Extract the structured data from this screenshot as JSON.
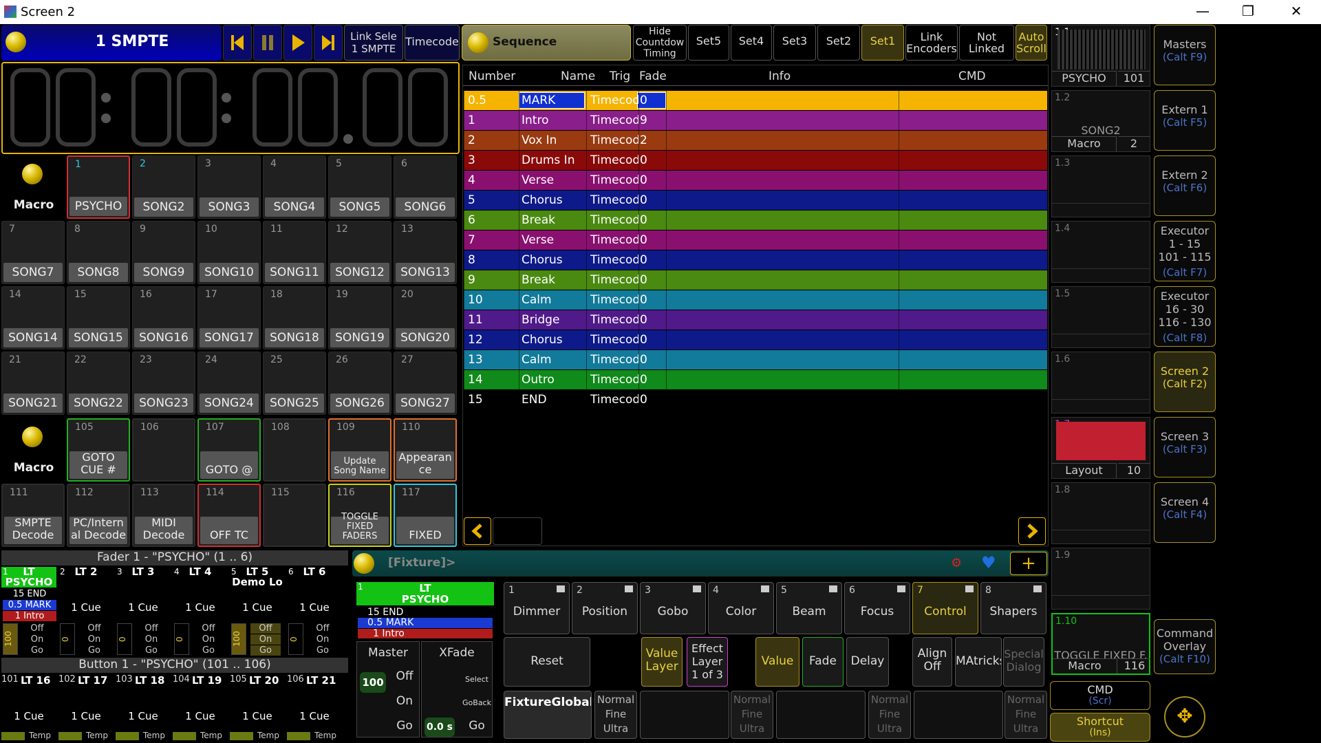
{
  "window": {
    "title": "Screen 2",
    "min": "—",
    "max": "❐",
    "close": "✕"
  },
  "timecode_bar": {
    "title": "1 SMPTE",
    "link_select": "Link Sele\n1 SMPTE",
    "timecode": "Timecode",
    "display": [
      "00",
      ":",
      "00",
      ":",
      "00",
      ".",
      "00"
    ]
  },
  "macro_label": "Macro",
  "song_grid": [
    {
      "n": "1",
      "name": "PSYCHO",
      "active": true
    },
    {
      "n": "2",
      "name": "SONG2"
    },
    {
      "n": "3",
      "name": "SONG3"
    },
    {
      "n": "4",
      "name": "SONG4"
    },
    {
      "n": "5",
      "name": "SONG5"
    },
    {
      "n": "6",
      "name": "SONG6"
    },
    {
      "n": "7",
      "name": "SONG7"
    },
    {
      "n": "8",
      "name": "SONG8"
    },
    {
      "n": "9",
      "name": "SONG9"
    },
    {
      "n": "10",
      "name": "SONG10"
    },
    {
      "n": "11",
      "name": "SONG11"
    },
    {
      "n": "12",
      "name": "SONG12"
    },
    {
      "n": "13",
      "name": "SONG13"
    },
    {
      "n": "14",
      "name": "SONG14"
    },
    {
      "n": "15",
      "name": "SONG15"
    },
    {
      "n": "16",
      "name": "SONG16"
    },
    {
      "n": "17",
      "name": "SONG17"
    },
    {
      "n": "18",
      "name": "SONG18"
    },
    {
      "n": "19",
      "name": "SONG19"
    },
    {
      "n": "20",
      "name": "SONG20"
    },
    {
      "n": "21",
      "name": "SONG21"
    },
    {
      "n": "22",
      "name": "SONG22"
    },
    {
      "n": "23",
      "name": "SONG23"
    },
    {
      "n": "24",
      "name": "SONG24"
    },
    {
      "n": "25",
      "name": "SONG25"
    },
    {
      "n": "26",
      "name": "SONG26"
    },
    {
      "n": "27",
      "name": "SONG27"
    }
  ],
  "macro_grid": [
    {
      "n": "105",
      "name": "GOTO\nCUE #",
      "border": "#23b023"
    },
    {
      "n": "106",
      "name": "",
      "border": "#2c2c2c"
    },
    {
      "n": "107",
      "name": "GOTO @",
      "border": "#23b023"
    },
    {
      "n": "108",
      "name": "",
      "border": "#2c2c2c"
    },
    {
      "n": "109",
      "name": "Update\nSong Name",
      "border": "#e07030",
      "small": true
    },
    {
      "n": "110",
      "name": "Appearan\nce",
      "border": "#e07030"
    },
    {
      "n": "111",
      "name": "SMPTE\nDecode",
      "border": "#2c2c2c"
    },
    {
      "n": "112",
      "name": "PC/Intern\nal Decode",
      "border": "#2c2c2c"
    },
    {
      "n": "113",
      "name": "MIDI\nDecode",
      "border": "#2c2c2c"
    },
    {
      "n": "114",
      "name": "OFF TC",
      "border": "#d23030"
    },
    {
      "n": "115",
      "name": "",
      "border": "#2c2c2c"
    },
    {
      "n": "116",
      "name": "TOGGLE\nFIXED\nFADERS",
      "border": "#c8d020",
      "small": true
    },
    {
      "n": "117",
      "name": "FIXED",
      "border": "#30c8e0"
    }
  ],
  "sequence": {
    "title": "Sequence",
    "buttons": [
      "Hide\nCountdow\nTiming",
      "Set5",
      "Set4",
      "Set3",
      "Set2",
      "Set1",
      "Link\nEncoders",
      "Not\nLinked",
      "Auto\nScroll"
    ],
    "headers": [
      "Number",
      "Name",
      "Trig",
      "Fade",
      "Info",
      "CMD"
    ],
    "rows": [
      {
        "num": "0.5",
        "name": "MARK",
        "trig": "Timecode",
        "fade": "0",
        "color": "#f5b400"
      },
      {
        "num": "1",
        "name": "Intro",
        "trig": "Timecode",
        "fade": "9",
        "color": "#8a1e8a"
      },
      {
        "num": "2",
        "name": "Vox In",
        "trig": "Timecode",
        "fade": "2",
        "color": "#9a3a10"
      },
      {
        "num": "3",
        "name": "Drums In",
        "trig": "Timecode",
        "fade": "0",
        "color": "#8a0a0a"
      },
      {
        "num": "4",
        "name": "Verse",
        "trig": "Timecode",
        "fade": "0",
        "color": "#8a1070"
      },
      {
        "num": "5",
        "name": "Chorus",
        "trig": "Timecode",
        "fade": "0",
        "color": "#0e1a8a"
      },
      {
        "num": "6",
        "name": "Break",
        "trig": "Timecode",
        "fade": "0",
        "color": "#4a8a10"
      },
      {
        "num": "7",
        "name": "Verse",
        "trig": "Timecode",
        "fade": "0",
        "color": "#8a1070"
      },
      {
        "num": "8",
        "name": "Chorus",
        "trig": "Timecode",
        "fade": "0",
        "color": "#0e1a8a"
      },
      {
        "num": "9",
        "name": "Break",
        "trig": "Timecode",
        "fade": "0",
        "color": "#4a8a10"
      },
      {
        "num": "10",
        "name": "Calm",
        "trig": "Timecode",
        "fade": "0",
        "color": "#127a9a"
      },
      {
        "num": "11",
        "name": "Bridge",
        "trig": "Timecode",
        "fade": "0",
        "color": "#501a8a"
      },
      {
        "num": "12",
        "name": "Chorus",
        "trig": "Timecode",
        "fade": "0",
        "color": "#0e1a8a"
      },
      {
        "num": "13",
        "name": "Calm",
        "trig": "Timecode",
        "fade": "0",
        "color": "#127a9a"
      },
      {
        "num": "14",
        "name": "Outro",
        "trig": "Timecode",
        "fade": "0",
        "color": "#108a1a"
      },
      {
        "num": "15",
        "name": "END",
        "trig": "Timecode",
        "fade": "0",
        "color": "#000000"
      }
    ]
  },
  "fader_section": {
    "title": "Fader  1  - \"PSYCHO\" (1 .. 6)",
    "button_title": "Button  1  - \"PSYCHO\" (101 .. 106)"
  },
  "faders": [
    {
      "n": "1",
      "name": "LT\nPSYCHO",
      "cues": [
        "15 END",
        "0.5 MARK",
        "1 Intro"
      ],
      "ctl": [
        "Off",
        "On",
        "Go"
      ],
      "val": "100",
      "active": true
    },
    {
      "n": "2",
      "name": "LT  2",
      "cue": "1 Cue",
      "ctl": [
        "Off",
        "On",
        "Go"
      ],
      "val": "0"
    },
    {
      "n": "3",
      "name": "LT  3",
      "cue": "1 Cue",
      "ctl": [
        "Off",
        "On",
        "Go"
      ],
      "val": "0"
    },
    {
      "n": "4",
      "name": "LT  4",
      "cue": "1 Cue",
      "ctl": [
        "Off",
        "On",
        "Go"
      ],
      "val": "0"
    },
    {
      "n": "5",
      "name": "LT  5\nDemo Lo",
      "cue": "1 Cue",
      "ctl": [
        "Off",
        "On",
        "Go"
      ],
      "val": "100"
    },
    {
      "n": "6",
      "name": "LT  6",
      "cue": "1 Cue",
      "ctl": [
        "Off",
        "On",
        "Go"
      ],
      "val": "0"
    }
  ],
  "buttons_row": [
    {
      "n": "101",
      "name": "LT 16",
      "cue": "1 Cue",
      "temp": "Temp"
    },
    {
      "n": "102",
      "name": "LT 17",
      "cue": "1 Cue",
      "temp": "Temp"
    },
    {
      "n": "103",
      "name": "LT 18",
      "cue": "1 Cue",
      "temp": "Temp"
    },
    {
      "n": "104",
      "name": "LT 19",
      "cue": "1 Cue",
      "temp": "Temp"
    },
    {
      "n": "105",
      "name": "LT 20",
      "cue": "1 Cue",
      "temp": "Temp"
    },
    {
      "n": "106",
      "name": "LT 21",
      "cue": "1 Cue",
      "temp": "Temp"
    }
  ],
  "fixture": {
    "title": "[Fixture]>",
    "exec": {
      "n": "1",
      "name": "LT\nPSYCHO",
      "cues": [
        "15 END",
        "0.5 MARK",
        "1 Intro"
      ]
    },
    "master": "Master",
    "xfade": "XFade",
    "master_val": "100",
    "xfade_val": "0.0 s",
    "master_btns": [
      "Off",
      "On",
      "Go"
    ],
    "xfade_btns": [
      "Select",
      "GoBack",
      "Go"
    ],
    "features": [
      {
        "n": "1",
        "name": "Dimmer"
      },
      {
        "n": "2",
        "name": "Position"
      },
      {
        "n": "3",
        "name": "Gobo"
      },
      {
        "n": "4",
        "name": "Color"
      },
      {
        "n": "5",
        "name": "Beam"
      },
      {
        "n": "6",
        "name": "Focus"
      },
      {
        "n": "7",
        "name": "Control"
      },
      {
        "n": "8",
        "name": "Shapers"
      }
    ],
    "reset": "Reset",
    "value_layer": "Value\nLayer",
    "effect_layer": "Effect\nLayer\n1 of 3",
    "value": "Value",
    "fade": "Fade",
    "delay": "Delay",
    "align": "Align\nOff",
    "matricks": "MAtricks",
    "special": "Special\nDialog",
    "fixture_global": "FixtureGlobal",
    "normal": "Normal\nFine\nUltra"
  },
  "views": [
    {
      "n": "1.1",
      "label": "PSYCHO",
      "val": "101"
    },
    {
      "n": "1.2",
      "title": "SONG2",
      "label": "Macro",
      "val": "2"
    },
    {
      "n": "1.3"
    },
    {
      "n": "1.4"
    },
    {
      "n": "1.5"
    },
    {
      "n": "1.6"
    },
    {
      "n": "1.7",
      "label": "Layout",
      "val": "10"
    },
    {
      "n": "1.8"
    },
    {
      "n": "1.9"
    },
    {
      "n": "1.10",
      "title": "TOGGLE FIXED F.",
      "label": "Macro",
      "val": "116"
    }
  ],
  "side": [
    {
      "name": "Masters",
      "key": "(Calt F9)"
    },
    {
      "name": "Extern 1",
      "key": "(Calt F5)"
    },
    {
      "name": "Extern 2",
      "key": "(Calt F6)"
    },
    {
      "name": "Executor\n1 - 15\n101 - 115",
      "key": "(Calt F7)"
    },
    {
      "name": "Executor\n16 - 30\n116 - 130",
      "key": "(Calt F8)"
    },
    {
      "name": "Screen 2",
      "key": "(Calt F2)",
      "active": true
    },
    {
      "name": "Screen 3",
      "key": "(Calt F3)"
    },
    {
      "name": "Screen 4",
      "key": "(Calt F4)"
    }
  ],
  "command_overlay": {
    "name": "Command\nOverlay",
    "key": "(Calt F10)"
  },
  "cmd": {
    "name": "CMD",
    "key": "(Scr)"
  },
  "shortcut": {
    "name": "Shortcut",
    "key": "(Ins)"
  }
}
